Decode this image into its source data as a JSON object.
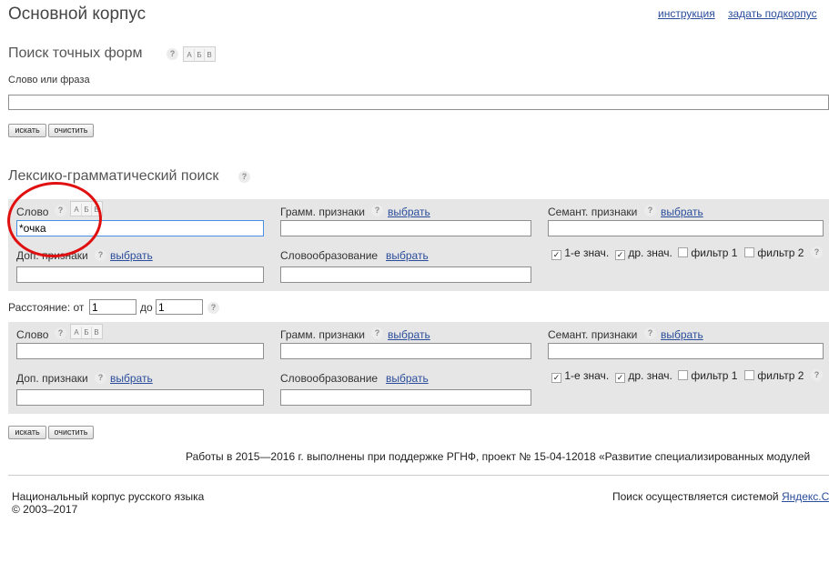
{
  "header": {
    "title": "Основной корпус",
    "link_instructions": "инструкция",
    "link_subcorpus": "задать подкорпус"
  },
  "exact": {
    "title": "Поиск точных форм",
    "field_label": "Слово или фраза",
    "value": "",
    "search_btn": "искать",
    "clear_btn": "очистить"
  },
  "lexgram": {
    "title": "Лексико-грамматический поиск",
    "help": "?",
    "keyboard": [
      "А",
      "Б",
      "В"
    ],
    "blocks": [
      {
        "word_label": "Слово",
        "word_value": "*очка",
        "gramm_label": "Грамм. признаки",
        "gramm_link": "выбрать",
        "sem_label": "Семант. признаки",
        "sem_link": "выбрать",
        "extra_label": "Доп. признаки",
        "extra_link": "выбрать",
        "deriv_label": "Словообразование",
        "deriv_link": "выбрать",
        "filters": [
          "1-е знач.",
          "др. знач.",
          "фильтр 1",
          "фильтр 2"
        ],
        "filters_checked": [
          true,
          true,
          false,
          false
        ]
      },
      {
        "word_label": "Слово",
        "word_value": "",
        "gramm_label": "Грамм. признаки",
        "gramm_link": "выбрать",
        "sem_label": "Семант. признаки",
        "sem_link": "выбрать",
        "extra_label": "Доп. признаки",
        "extra_link": "выбрать",
        "deriv_label": "Словообразование",
        "deriv_link": "выбрать",
        "filters": [
          "1-е знач.",
          "др. знач.",
          "фильтр 1",
          "фильтр 2"
        ],
        "filters_checked": [
          true,
          true,
          false,
          false
        ]
      }
    ],
    "distance": {
      "label_from": "Расстояние: от",
      "from": "1",
      "label_to": "до",
      "to": "1"
    },
    "search_btn": "искать",
    "clear_btn": "очистить"
  },
  "grant_text": "Работы в 2015—2016 г. выполнены при поддержке РГНФ, проект № 15-04-12018 «Развитие специализированных модулей",
  "footer": {
    "corpus_name": "Национальный корпус русского языка",
    "copyright": "© 2003–2017",
    "search_by": "Поиск осуществляется системой",
    "search_link": "Яндекс.С"
  },
  "colors": {
    "link": "#2a4d9b",
    "panel_bg": "#e6e6e6",
    "annotation_circle": "#e01010",
    "focus_border": "#4a90e2"
  }
}
